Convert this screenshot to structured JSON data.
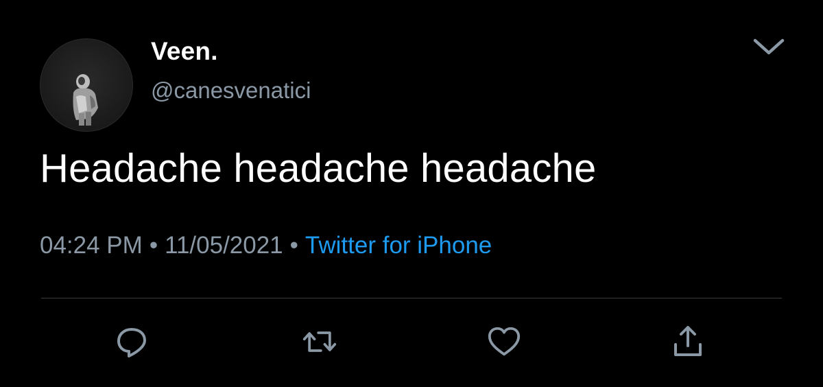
{
  "tweet": {
    "display_name": "Veen.",
    "handle": "@canesvenatici",
    "text": "Headache headache headache",
    "time": "04:24 PM",
    "date": "11/05/2021",
    "separator": "•",
    "source": "Twitter for iPhone"
  },
  "icons": {
    "more": "chevron-down-icon",
    "reply": "reply-icon",
    "retweet": "retweet-icon",
    "like": "heart-icon",
    "share": "share-icon"
  },
  "colors": {
    "background": "#000000",
    "primary_text": "#ffffff",
    "secondary_text": "#8b98a5",
    "link": "#1d9bf0",
    "divider": "#3a3d40"
  }
}
